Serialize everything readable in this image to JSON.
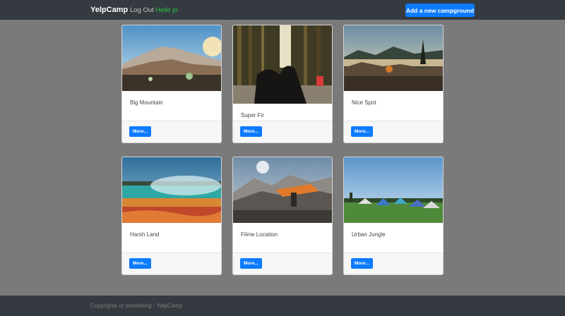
{
  "navbar": {
    "brand": "YelpCamp",
    "logout_label": "Log Out",
    "greeting": "Hello jo",
    "add_button_label": "Add a new campground"
  },
  "campgrounds": [
    {
      "title": "Big Mountain",
      "more_label": "More..."
    },
    {
      "title": "Super Fir",
      "more_label": "More..."
    },
    {
      "title": "Nice Spot",
      "more_label": "More..."
    },
    {
      "title": "Harsh Land",
      "more_label": "More..."
    },
    {
      "title": "Filme Location",
      "more_label": "More..."
    },
    {
      "title": "Urban Jungle",
      "more_label": "More..."
    }
  ],
  "footer": {
    "text": "Copyrights or something - YelpCamp"
  },
  "colors": {
    "navbar_bg": "#343a40",
    "page_bg": "#7a7a7a",
    "primary": "#0d7bfe",
    "greeting": "#28c745"
  }
}
